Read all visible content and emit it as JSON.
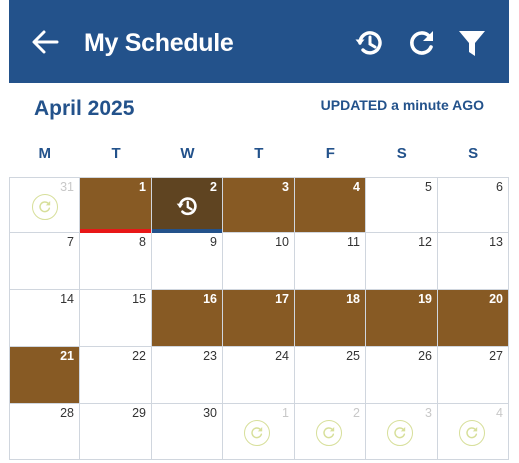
{
  "header": {
    "title": "My Schedule",
    "back_icon": "arrow-left-icon",
    "history_icon": "history-icon",
    "refresh_icon": "refresh-icon",
    "filter_icon": "filter-icon"
  },
  "calendar": {
    "month_label": "April 2025",
    "updated_label": "UPDATED a minute AGO",
    "weekdays": [
      "M",
      "T",
      "W",
      "T",
      "F",
      "S",
      "S"
    ],
    "colors": {
      "header_bg": "#23528b",
      "shift_fill": "#875a24",
      "today_fill": "#5f4421",
      "red_marker": "#e81717",
      "blue_marker": "#23528b",
      "sync_ring": "#d7df9a"
    },
    "weeks": [
      [
        {
          "day": "31",
          "other": true,
          "sync": true
        },
        {
          "day": "1",
          "filled": true,
          "marker": "red"
        },
        {
          "day": "2",
          "filled": true,
          "today": true,
          "marker": "blue",
          "history": true
        },
        {
          "day": "3",
          "filled": true
        },
        {
          "day": "4",
          "filled": true
        },
        {
          "day": "5"
        },
        {
          "day": "6"
        }
      ],
      [
        {
          "day": "7"
        },
        {
          "day": "8"
        },
        {
          "day": "9"
        },
        {
          "day": "10"
        },
        {
          "day": "11"
        },
        {
          "day": "12"
        },
        {
          "day": "13"
        }
      ],
      [
        {
          "day": "14"
        },
        {
          "day": "15"
        },
        {
          "day": "16",
          "filled": true
        },
        {
          "day": "17",
          "filled": true
        },
        {
          "day": "18",
          "filled": true
        },
        {
          "day": "19",
          "filled": true
        },
        {
          "day": "20",
          "filled": true
        }
      ],
      [
        {
          "day": "21",
          "filled": true
        },
        {
          "day": "22"
        },
        {
          "day": "23"
        },
        {
          "day": "24"
        },
        {
          "day": "25"
        },
        {
          "day": "26"
        },
        {
          "day": "27"
        }
      ],
      [
        {
          "day": "28"
        },
        {
          "day": "29"
        },
        {
          "day": "30"
        },
        {
          "day": "1",
          "other": true,
          "sync": true
        },
        {
          "day": "2",
          "other": true,
          "sync": true
        },
        {
          "day": "3",
          "other": true,
          "sync": true
        },
        {
          "day": "4",
          "other": true,
          "sync": true
        }
      ]
    ]
  }
}
